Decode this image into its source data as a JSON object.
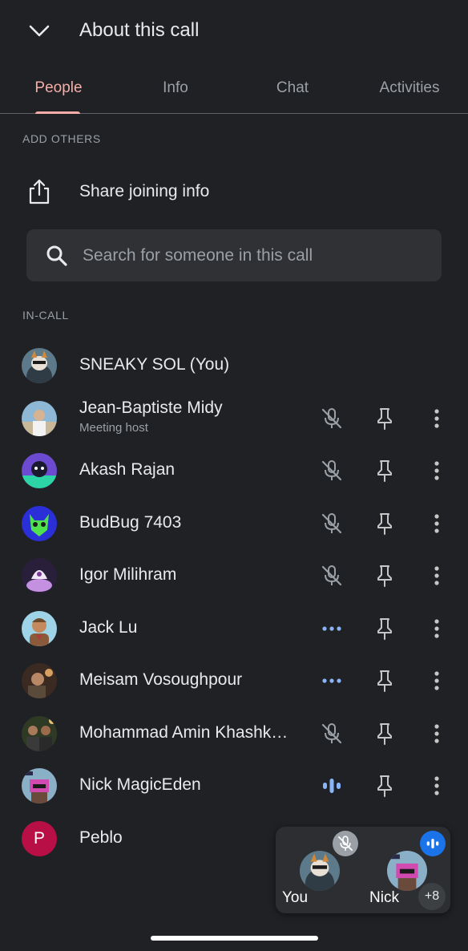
{
  "header": {
    "title": "About this call",
    "back_icon": "chevron-down-icon"
  },
  "tabs": [
    {
      "label": "People",
      "active": true
    },
    {
      "label": "Info",
      "active": false
    },
    {
      "label": "Chat",
      "active": false
    },
    {
      "label": "Activities",
      "active": false
    }
  ],
  "add_others": {
    "section_label": "ADD OTHERS",
    "share_label": "Share joining info",
    "share_icon": "share-icon"
  },
  "search": {
    "placeholder": "Search for someone in this call",
    "value": ""
  },
  "in_call": {
    "section_label": "IN-CALL",
    "participants": [
      {
        "name": "SNEAKY SOL (You)",
        "subtitle": "",
        "status": "self"
      },
      {
        "name": "Jean-Baptiste Midy",
        "subtitle": "Meeting host",
        "status": "muted"
      },
      {
        "name": "Akash Rajan",
        "subtitle": "",
        "status": "muted"
      },
      {
        "name": "BudBug 7403",
        "subtitle": "",
        "status": "muted"
      },
      {
        "name": "Igor Milihram",
        "subtitle": "",
        "status": "muted"
      },
      {
        "name": "Jack Lu",
        "subtitle": "",
        "status": "connecting"
      },
      {
        "name": "Meisam Vosoughpour",
        "subtitle": "",
        "status": "connecting"
      },
      {
        "name": "Mohammad Amin Khashk…",
        "subtitle": "",
        "status": "muted"
      },
      {
        "name": "Nick MagicEden",
        "subtitle": "",
        "status": "speaking"
      },
      {
        "name": "Peblo",
        "subtitle": "",
        "status": "none",
        "initial": "P"
      }
    ]
  },
  "pip": {
    "you_label": "You",
    "other_label": "Nick",
    "extra_count": "+8"
  },
  "colors": {
    "background": "#202124",
    "accent_tab": "#f6aea9",
    "speaking_blue": "#1a73e8",
    "icon_blue": "#8ab4f8",
    "peblo_avatar": "#b80f46"
  }
}
